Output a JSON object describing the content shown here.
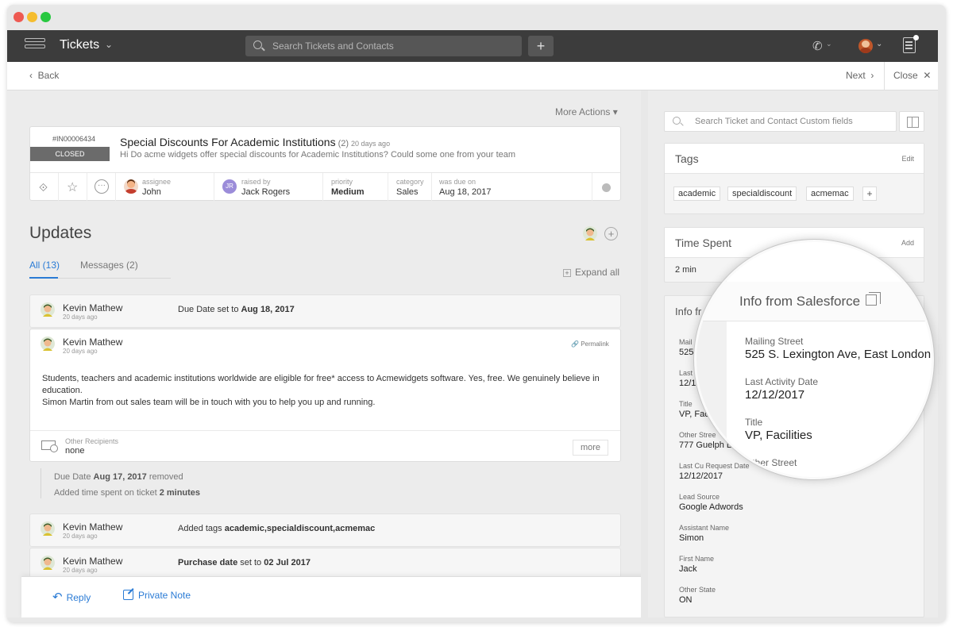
{
  "header": {
    "module_title": "Tickets",
    "search_placeholder": "Search Tickets and Contacts",
    "add_label": "+"
  },
  "nav": {
    "back": "Back",
    "next": "Next",
    "close": "Close"
  },
  "main": {
    "more_actions": "More Actions",
    "ticket": {
      "id": "#IN00006434",
      "status": "CLOSED",
      "subject": "Special Discounts For Academic Institutions",
      "count": "(2)",
      "age": "20 days ago",
      "description": "Hi Do acme widgets offer special discounts for Academic Institutions? Could some one from your team",
      "assignee_label": "assignee",
      "assignee": "John",
      "raised_by_label": "raised by",
      "raised_by": "Jack Rogers",
      "raised_by_initials": "JR",
      "priority_label": "priority",
      "priority": "Medium",
      "category_label": "category",
      "category": "Sales",
      "due_label": "was due on",
      "due": "Aug 18, 2017"
    },
    "updates_title": "Updates",
    "tabs": [
      {
        "label": "All (13)"
      },
      {
        "label": "Messages (2)"
      }
    ],
    "expand_all": "Expand all",
    "updates": [
      {
        "name": "Kevin Mathew",
        "age": "20 days ago",
        "prefix": "Due Date set to ",
        "bold": "Aug 18, 2017",
        "suffix": ""
      },
      {
        "name": "Kevin Mathew",
        "age": "20 days ago",
        "prefix": "Added tags ",
        "bold": "academic,specialdiscount,acmemac",
        "suffix": ""
      },
      {
        "name": "Kevin Mathew",
        "age": "20 days ago",
        "prefix": "",
        "bold": "Purchase date",
        "suffix": " set to ",
        "bold2": "02 Jul 2017"
      }
    ],
    "message": {
      "name": "Kevin Mathew",
      "age": "20 days ago",
      "permalink": "Permalink",
      "line1": "Students, teachers and academic institutions worldwide are eligible for free* access to Acmewidgets software. Yes, free. We genuinely believe in education.",
      "line2": "Simon Martin from out sales team will be in touch with you to help you up and running.",
      "recipients_label": "Other Recipients",
      "recipients": "none",
      "more": "more"
    },
    "activities": [
      {
        "prefix": "Due Date ",
        "bold": "Aug 17, 2017",
        "suffix": " removed"
      },
      {
        "prefix": "Added time spent on ticket ",
        "bold": "2 minutes",
        "suffix": ""
      }
    ],
    "compose": {
      "reply": "Reply",
      "private_note": "Private Note"
    }
  },
  "sidebar": {
    "search_placeholder": "Search Ticket and Contact Custom fields",
    "tags_title": "Tags",
    "tags_edit": "Edit",
    "tags": [
      "academic",
      "specialdiscount",
      "acmemac"
    ],
    "time_title": "Time Spent",
    "time_add": "Add",
    "time_value": "2 min",
    "info_title_partial": "Info fr",
    "fields": [
      {
        "label": "Mail",
        "value": "525"
      },
      {
        "label": "Last",
        "value": "12/1"
      },
      {
        "label": "Title",
        "value": "VP, Fac"
      },
      {
        "label": "Other Stree",
        "value": "777 Guelph L"
      },
      {
        "label": "Last Cu Request Date",
        "value": "12/12/2017"
      },
      {
        "label": "Lead Source",
        "value": "Google Adwords"
      },
      {
        "label": "Assistant Name",
        "value": "Simon"
      },
      {
        "label": "First Name",
        "value": "Jack"
      },
      {
        "label": "Other State",
        "value": "ON"
      }
    ]
  },
  "magnifier": {
    "title": "Info from Salesforce",
    "fields": [
      {
        "label": "Mailing Street",
        "value": "525 S. Lexington Ave, East London"
      },
      {
        "label": "Last Activity Date",
        "value": "12/12/2017"
      },
      {
        "label": "Title",
        "value": "VP, Facilities"
      },
      {
        "label": "Other Street",
        "value": ""
      }
    ]
  },
  "icons": {
    "menu": "menu-icon",
    "search": "search-icon",
    "phone": "phone-icon",
    "notifications": "notifications-icon",
    "pin": "pin-icon",
    "star": "star-icon",
    "more": "more-icon",
    "mail": "mail-icon",
    "reply": "reply-icon",
    "note": "note-icon",
    "link": "link-icon",
    "book": "book-icon",
    "external": "external-link-icon"
  },
  "colors": {
    "accent": "#2a7bd5",
    "topbar": "#3c3c3c",
    "status_closed": "#6b6b6b"
  }
}
